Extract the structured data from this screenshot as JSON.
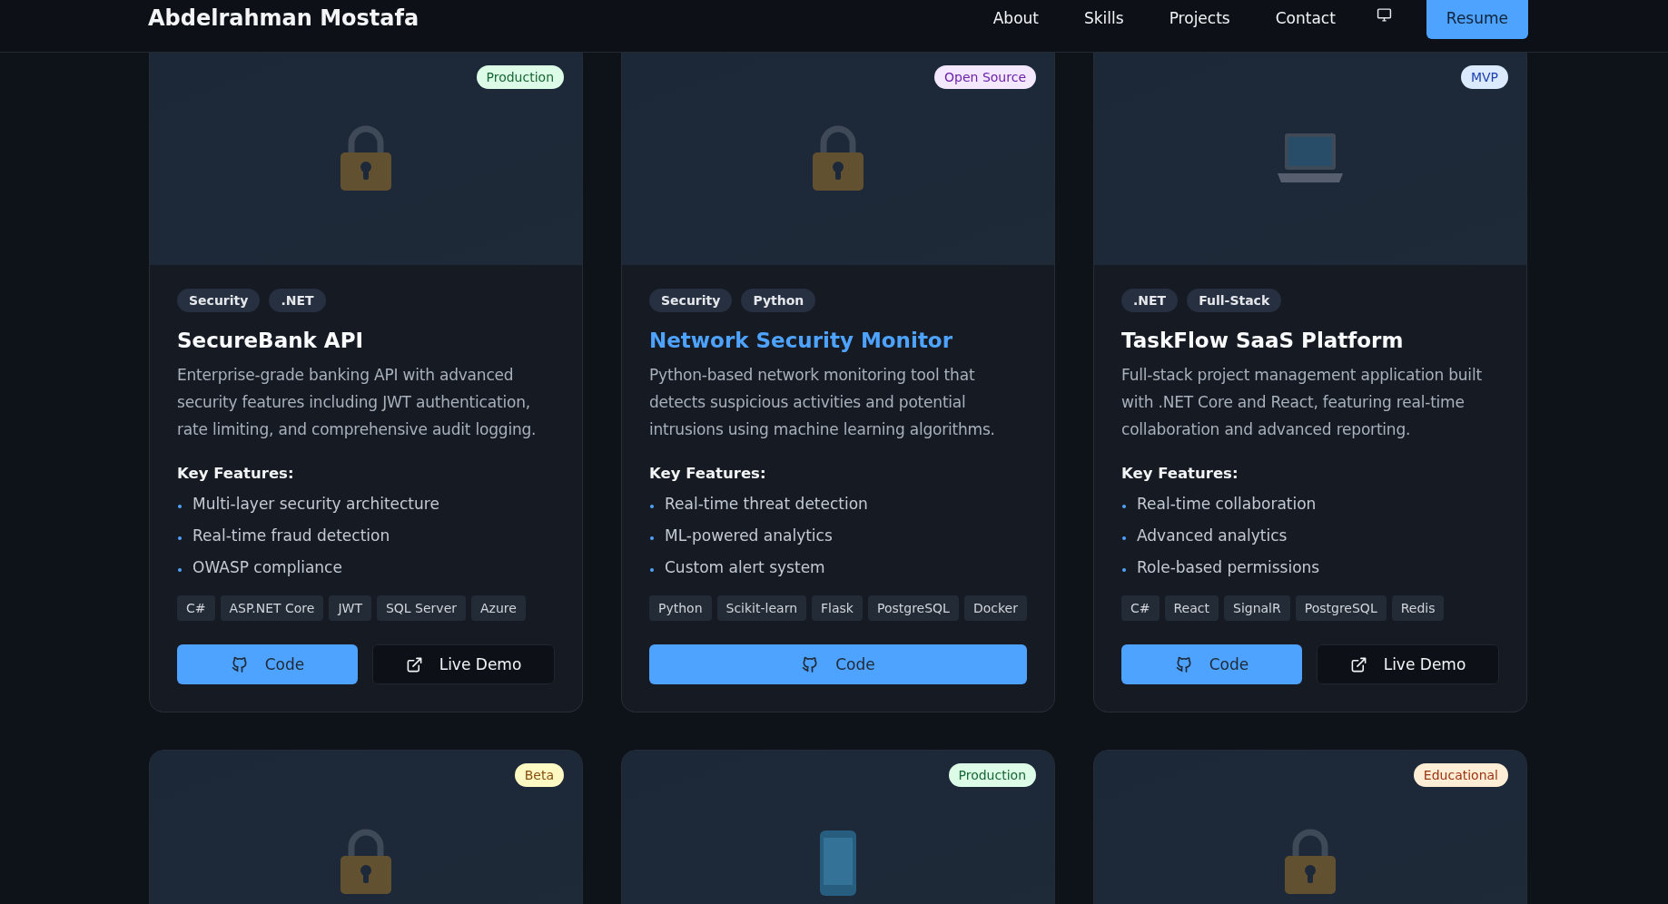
{
  "header": {
    "brand": "Abdelrahman Mostafa",
    "nav": [
      "About",
      "Skills",
      "Projects",
      "Contact"
    ],
    "resume": "Resume"
  },
  "projects": [
    {
      "status": {
        "label": "Production",
        "kind": "production"
      },
      "kind": "lock",
      "hovered": false,
      "categories": [
        "Security",
        ".NET"
      ],
      "title": "SecureBank API",
      "description": "Enterprise-grade banking API with advanced security features including JWT authentication, rate limiting, and comprehensive audit logging.",
      "features_heading": "Key Features:",
      "features": [
        "Multi-layer security architecture",
        "Real-time fraud detection",
        "OWASP compliance"
      ],
      "tech": [
        "C#",
        "ASP.NET Core",
        "JWT",
        "SQL Server",
        "Azure"
      ],
      "buttons": [
        {
          "kind": "code",
          "label": "Code"
        },
        {
          "kind": "demo",
          "label": "Live Demo"
        }
      ]
    },
    {
      "status": {
        "label": "Open Source",
        "kind": "open-source"
      },
      "kind": "lock",
      "hovered": true,
      "categories": [
        "Security",
        "Python"
      ],
      "title": "Network Security Monitor",
      "description": "Python-based network monitoring tool that detects suspicious activities and potential intrusions using machine learning algorithms.",
      "features_heading": "Key Features:",
      "features": [
        "Real-time threat detection",
        "ML-powered analytics",
        "Custom alert system"
      ],
      "tech": [
        "Python",
        "Scikit-learn",
        "Flask",
        "PostgreSQL",
        "Docker"
      ],
      "buttons": [
        {
          "kind": "code",
          "label": "Code"
        }
      ]
    },
    {
      "status": {
        "label": "MVP",
        "kind": "mvp"
      },
      "kind": "laptop",
      "hovered": false,
      "categories": [
        ".NET",
        "Full-Stack"
      ],
      "title": "TaskFlow SaaS Platform",
      "description": "Full-stack project management application built with .NET Core and React, featuring real-time collaboration and advanced reporting.",
      "features_heading": "Key Features:",
      "features": [
        "Real-time collaboration",
        "Advanced analytics",
        "Role-based permissions"
      ],
      "tech": [
        "C#",
        "React",
        "SignalR",
        "PostgreSQL",
        "Redis"
      ],
      "buttons": [
        {
          "kind": "code",
          "label": "Code"
        },
        {
          "kind": "demo",
          "label": "Live Demo"
        }
      ]
    },
    {
      "status": {
        "label": "Beta",
        "kind": "beta"
      },
      "kind": "lock"
    },
    {
      "status": {
        "label": "Production",
        "kind": "production"
      },
      "kind": "phone"
    },
    {
      "status": {
        "label": "Educational",
        "kind": "educational"
      },
      "kind": "lock"
    }
  ]
}
